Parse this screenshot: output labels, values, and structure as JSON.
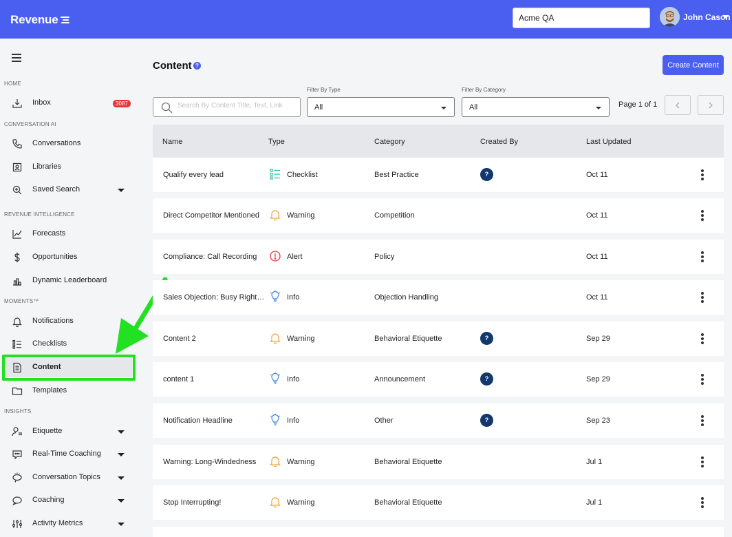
{
  "app": {
    "logo": "Revenue",
    "workspace": "Acme QA",
    "user_name": "John Cason"
  },
  "sidebar": {
    "sections": {
      "home": "HOME",
      "conversation_ai": "CONVERSATION AI",
      "revenue_intelligence": "REVENUE INTELLIGENCE",
      "moments": "MOMENTS™",
      "insights": "INSIGHTS"
    },
    "items": [
      {
        "label": "Inbox",
        "badge": "3087"
      },
      {
        "label": "Conversations"
      },
      {
        "label": "Libraries"
      },
      {
        "label": "Saved Search"
      },
      {
        "label": "Forecasts"
      },
      {
        "label": "Opportunities"
      },
      {
        "label": "Dynamic Leaderboard"
      },
      {
        "label": "Notifications"
      },
      {
        "label": "Checklists"
      },
      {
        "label": "Content"
      },
      {
        "label": "Templates"
      },
      {
        "label": "Etiquette"
      },
      {
        "label": "Real-Time Coaching"
      },
      {
        "label": "Conversation Topics"
      },
      {
        "label": "Coaching"
      },
      {
        "label": "Activity Metrics"
      }
    ],
    "active_item": "Content"
  },
  "main": {
    "title": "Content",
    "create_label": "Create Content",
    "search_placeholder": "Search By Content Title, Text, Link",
    "filter_type_label": "Filter By Type",
    "filter_type_value": "All",
    "filter_category_label": "Filter By Category",
    "filter_category_value": "All",
    "page_info": "Page 1 of 1",
    "columns": [
      "Name",
      "Type",
      "Category",
      "Created By",
      "Last Updated"
    ],
    "rows": [
      {
        "name": "Qualify every lead",
        "type": "Checklist",
        "category": "Best Practice",
        "created_by": "?",
        "date": "Oct 11"
      },
      {
        "name": "Direct Competitor Mentioned",
        "type": "Warning",
        "category": "Competition",
        "created_by": "",
        "date": "Oct 11"
      },
      {
        "name": "Compliance: Call Recording",
        "type": "Alert",
        "category": "Policy",
        "created_by": "",
        "date": "Oct 11"
      },
      {
        "name": "Sales Objection: Busy Right N...",
        "type": "Info",
        "category": "Objection Handling",
        "created_by": "",
        "date": "Oct 11"
      },
      {
        "name": "Content 2",
        "type": "Warning",
        "category": "Behavioral Etiquette",
        "created_by": "?",
        "date": "Sep 29"
      },
      {
        "name": "content 1",
        "type": "Info",
        "category": "Announcement",
        "created_by": "?",
        "date": "Sep 29"
      },
      {
        "name": "Notification Headline",
        "type": "Info",
        "category": "Other",
        "created_by": "?",
        "date": "Sep 23"
      },
      {
        "name": "Warning: Long-Windedness",
        "type": "Warning",
        "category": "Behavioral Etiquette",
        "created_by": "",
        "date": "Jul 1"
      },
      {
        "name": "Stop Interrupting!",
        "type": "Warning",
        "category": "Behavioral Etiquette",
        "created_by": "",
        "date": "Jul 1"
      }
    ]
  },
  "colors": {
    "brand": "#4a5ef0",
    "annotation_green": "#22e022",
    "checklist": "#2bbfa6",
    "warning": "#f2a23a",
    "alert": "#e53939",
    "info": "#3d86e8",
    "creator": "#13386e"
  }
}
